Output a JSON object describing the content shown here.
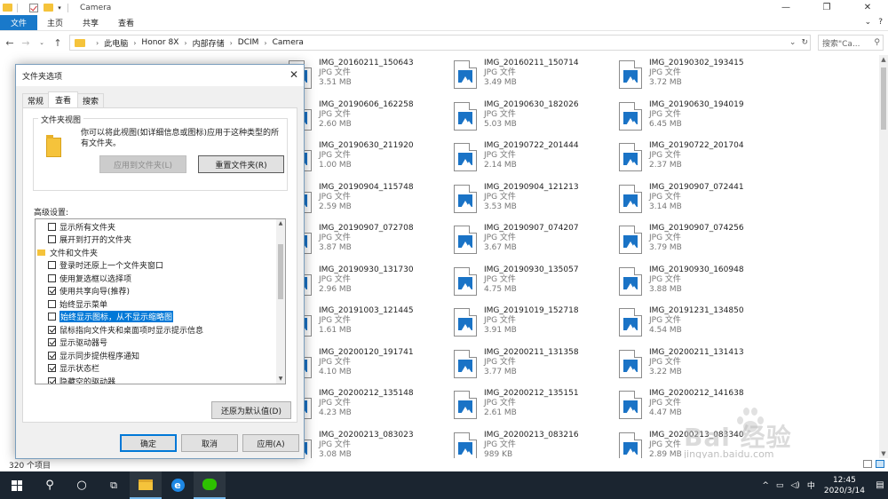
{
  "window": {
    "title": "Camera",
    "controls": {
      "minimize": "—",
      "restore": "❐",
      "close": "✕"
    }
  },
  "ribbon": {
    "tabs": [
      {
        "label": "文件",
        "active": true
      },
      {
        "label": "主页",
        "active": false
      },
      {
        "label": "共享",
        "active": false
      },
      {
        "label": "查看",
        "active": false
      }
    ],
    "right_expand": "⌄",
    "help": "?"
  },
  "address": {
    "crumbs": [
      "此电脑",
      "Honor 8X",
      "内部存储",
      "DCIM",
      "Camera"
    ],
    "search_placeholder": "搜索\"Ca..."
  },
  "files": [
    {
      "name": "IMG_20160211_150643",
      "type": "JPG 文件",
      "size": "3.51 MB"
    },
    {
      "name": "IMG_20160211_150714",
      "type": "JPG 文件",
      "size": "3.49 MB"
    },
    {
      "name": "IMG_20190302_193415",
      "type": "JPG 文件",
      "size": "3.72 MB"
    },
    {
      "name": "IMG_20190606_162258",
      "type": "JPG 文件",
      "size": "2.60 MB"
    },
    {
      "name": "IMG_20190630_182026",
      "type": "JPG 文件",
      "size": "5.03 MB"
    },
    {
      "name": "IMG_20190630_194019",
      "type": "JPG 文件",
      "size": "6.45 MB"
    },
    {
      "name": "IMG_20190630_211920",
      "type": "JPG 文件",
      "size": "1.00 MB"
    },
    {
      "name": "IMG_20190722_201444",
      "type": "JPG 文件",
      "size": "2.14 MB"
    },
    {
      "name": "IMG_20190722_201704",
      "type": "JPG 文件",
      "size": "2.37 MB"
    },
    {
      "name": "IMG_20190904_115748",
      "type": "JPG 文件",
      "size": "2.59 MB"
    },
    {
      "name": "IMG_20190904_121213",
      "type": "JPG 文件",
      "size": "3.53 MB"
    },
    {
      "name": "IMG_20190907_072441",
      "type": "JPG 文件",
      "size": "3.14 MB"
    },
    {
      "name": "IMG_20190907_072708",
      "type": "JPG 文件",
      "size": "3.87 MB"
    },
    {
      "name": "IMG_20190907_074207",
      "type": "JPG 文件",
      "size": "3.67 MB"
    },
    {
      "name": "IMG_20190907_074256",
      "type": "JPG 文件",
      "size": "3.79 MB"
    },
    {
      "name": "IMG_20190930_131730",
      "type": "JPG 文件",
      "size": "2.96 MB"
    },
    {
      "name": "IMG_20190930_135057",
      "type": "JPG 文件",
      "size": "4.75 MB"
    },
    {
      "name": "IMG_20190930_160948",
      "type": "JPG 文件",
      "size": "3.88 MB"
    },
    {
      "name": "IMG_20191003_121445",
      "type": "JPG 文件",
      "size": "1.61 MB"
    },
    {
      "name": "IMG_20191019_152718",
      "type": "JPG 文件",
      "size": "3.91 MB"
    },
    {
      "name": "IMG_20191231_134850",
      "type": "JPG 文件",
      "size": "4.54 MB"
    },
    {
      "name": "IMG_20200120_191741",
      "type": "JPG 文件",
      "size": "4.10 MB"
    },
    {
      "name": "IMG_20200211_131358",
      "type": "JPG 文件",
      "size": "3.77 MB"
    },
    {
      "name": "IMG_20200211_131413",
      "type": "JPG 文件",
      "size": "3.22 MB"
    },
    {
      "name": "IMG_20200212_135148",
      "type": "JPG 文件",
      "size": "4.23 MB"
    },
    {
      "name": "IMG_20200212_135151",
      "type": "JPG 文件",
      "size": "2.61 MB"
    },
    {
      "name": "IMG_20200212_141638",
      "type": "JPG 文件",
      "size": "4.47 MB"
    },
    {
      "name": "IMG_20200213_083023",
      "type": "JPG 文件",
      "size": "3.08 MB"
    },
    {
      "name": "IMG_20200213_083216",
      "type": "JPG 文件",
      "size": "989 KB"
    },
    {
      "name": "IMG_20200213_083340",
      "type": "JPG 文件",
      "size": "2.89 MB"
    }
  ],
  "status": {
    "item_count": "320 个项目"
  },
  "dialog": {
    "title": "文件夹选项",
    "tabs": [
      {
        "label": "常规",
        "active": false
      },
      {
        "label": "查看",
        "active": true
      },
      {
        "label": "搜索",
        "active": false
      }
    ],
    "folder_views": {
      "legend": "文件夹视图",
      "description": "你可以将此视图(如详细信息或图标)应用于这种类型的所有文件夹。",
      "apply_button": "应用到文件夹(L)",
      "reset_button": "重置文件夹(R)"
    },
    "advanced_label": "高级设置:",
    "settings": [
      {
        "label": "显示所有文件夹",
        "checked": false,
        "kind": "sub"
      },
      {
        "label": "展开到打开的文件夹",
        "checked": false,
        "kind": "sub"
      },
      {
        "label": "文件和文件夹",
        "checked": null,
        "kind": "cat"
      },
      {
        "label": "登录时还原上一个文件夹窗口",
        "checked": false,
        "kind": "sub"
      },
      {
        "label": "使用复选框以选择项",
        "checked": false,
        "kind": "sub"
      },
      {
        "label": "使用共享向导(推荐)",
        "checked": true,
        "kind": "sub"
      },
      {
        "label": "始终显示菜单",
        "checked": false,
        "kind": "sub"
      },
      {
        "label": "始终显示图标，从不显示缩略图",
        "checked": false,
        "kind": "sub",
        "highlighted": true
      },
      {
        "label": "鼠标指向文件夹和桌面项时显示提示信息",
        "checked": true,
        "kind": "sub"
      },
      {
        "label": "显示驱动器号",
        "checked": true,
        "kind": "sub"
      },
      {
        "label": "显示同步提供程序通知",
        "checked": true,
        "kind": "sub"
      },
      {
        "label": "显示状态栏",
        "checked": true,
        "kind": "sub"
      },
      {
        "label": "隐藏空的驱动器",
        "checked": true,
        "kind": "sub"
      }
    ],
    "restore_defaults": "还原为默认值(D)",
    "ok": "确定",
    "cancel": "取消",
    "apply": "应用(A)",
    "close_glyph": "✕"
  },
  "taskbar": {
    "time": "12:45",
    "date": "2020/3/14",
    "ime": "中",
    "tray_chevron": "^"
  },
  "watermark": {
    "brand": "Bai 经验",
    "url": "jingyan.baidu.com"
  },
  "colors": {
    "accent": "#1979ca",
    "selection": "#0078d7",
    "folder": "#f5c33b",
    "taskbar": "#1b2530"
  }
}
